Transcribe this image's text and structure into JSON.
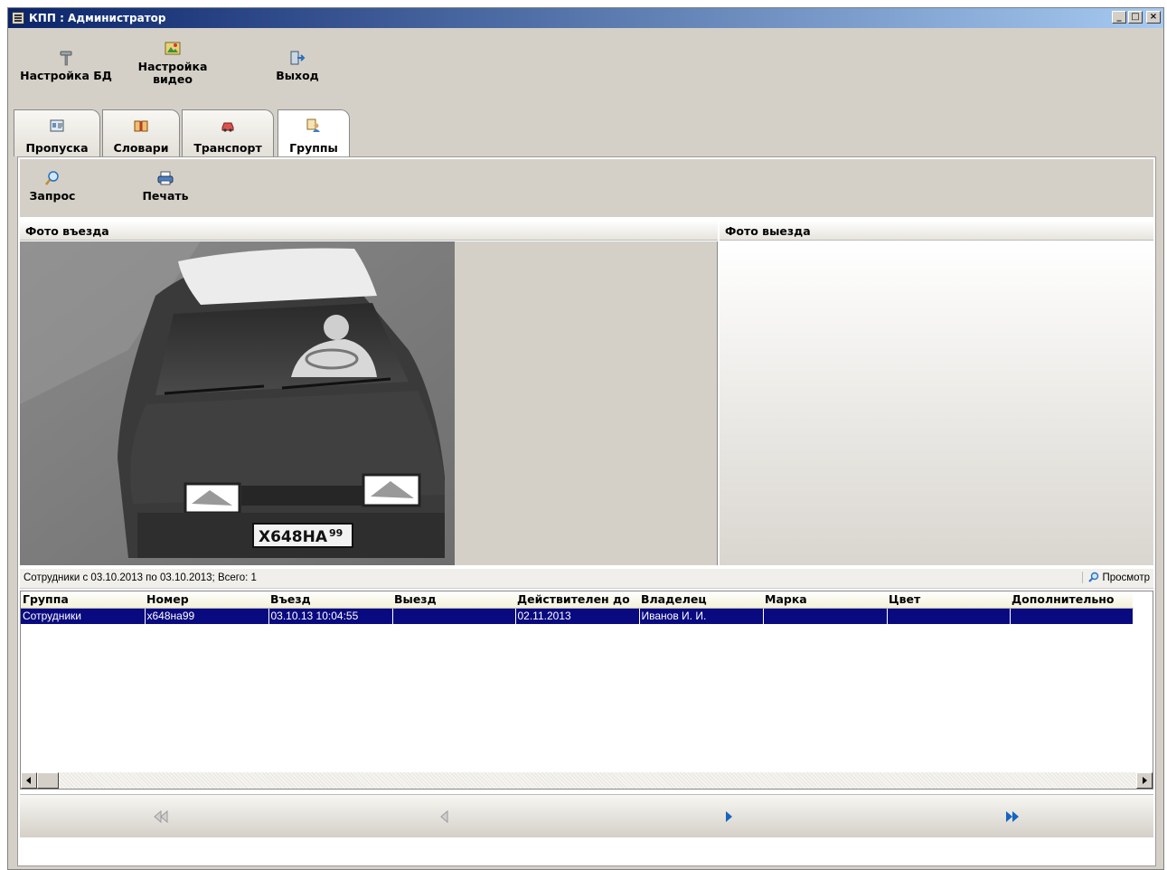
{
  "window": {
    "title": "КПП : Администратор",
    "minimize": "_",
    "maximize": "□",
    "close": "×"
  },
  "toolbar": {
    "db_settings": "Настройка БД",
    "video_settings_line1": "Настройка",
    "video_settings_line2": "видео",
    "exit": "Выход"
  },
  "tabs": [
    {
      "label": "Пропуска"
    },
    {
      "label": "Словари"
    },
    {
      "label": "Транспорт"
    },
    {
      "label": "Группы"
    }
  ],
  "active_tab": "Группы",
  "subtoolbar": {
    "query": "Запрос",
    "print": "Печать"
  },
  "photos": {
    "entry_title": "Фото въезда",
    "exit_title": "Фото выезда",
    "plate_text": "X648HA",
    "plate_region": "99"
  },
  "status": {
    "text": "Сотрудники с 03.10.2013 по 03.10.2013; Всего: 1",
    "view_button": "Просмотр"
  },
  "grid": {
    "columns": [
      "Группа",
      "Номер",
      "Въезд",
      "Выезд",
      "Действителен до",
      "Владелец",
      "Марка",
      "Цвет",
      "Дополнительно"
    ],
    "rows": [
      [
        "Сотрудники",
        "х648на99",
        "03.10.13 10:04:55",
        "",
        "02.11.2013",
        "Иванов И. И.",
        "",
        "",
        ""
      ]
    ]
  },
  "colors": {
    "titlebar_start": "#0a246a",
    "titlebar_end": "#a6caf0",
    "selection": "#0a0a80",
    "face": "#d4d0c8",
    "nav_active": "#1565c0"
  }
}
